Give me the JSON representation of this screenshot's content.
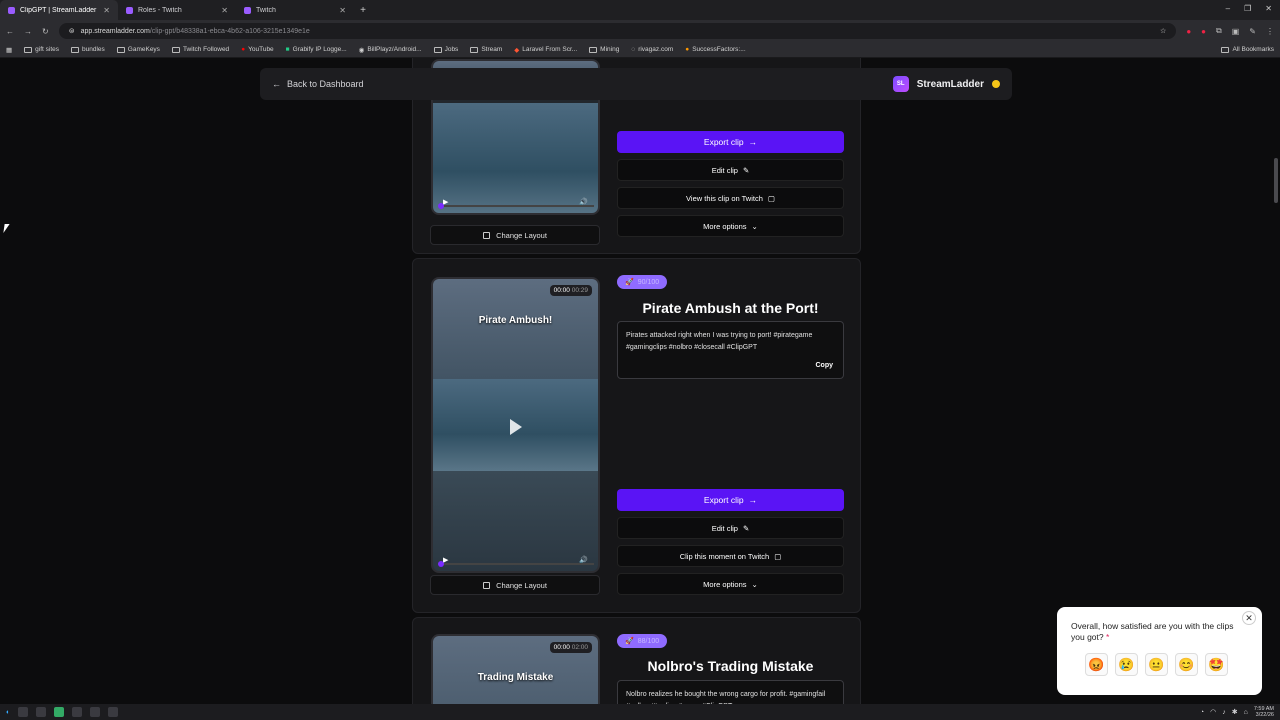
{
  "browser": {
    "tabs": [
      {
        "label": "ClipGPT | StreamLadder",
        "active": true
      },
      {
        "label": "Roles - Twitch",
        "active": false
      },
      {
        "label": "Twitch",
        "active": false
      }
    ],
    "url_host": "app.streamladder.com",
    "url_path": "/clip-gpt/b48338a1-ebca-4b62-a106-3215e1349e1e",
    "bookmarks": [
      "gift sites",
      "bundles",
      "GameKeys",
      "Twitch Followed",
      "YouTube",
      "Grabify IP Logge...",
      "BillPlayz/Android...",
      "Jobs",
      "Stream",
      "Laravel From Scr...",
      "Mining",
      "rivagaz.com",
      "SuccessFactors:..."
    ],
    "all_bookmarks": "All Bookmarks"
  },
  "header": {
    "back_label": "Back to Dashboard",
    "brand_logo": "SL",
    "brand_name": "StreamLadder"
  },
  "clips": [
    {
      "export_label": "Export clip",
      "edit_label": "Edit clip",
      "twitch_label": "View this clip on Twitch",
      "more_label": "More options",
      "layout_label": "Change Layout"
    },
    {
      "score": "90/100",
      "time_current": "00:00",
      "time_total": "00:29",
      "video_title": "Pirate Ambush!",
      "title": "Pirate Ambush at the Port!",
      "description": "Pirates attacked right when I was trying to port! #pirategame #gamingclips #nolbro #closecall #ClipGPT",
      "copy_label": "Copy",
      "export_label": "Export clip",
      "edit_label": "Edit clip",
      "twitch_label": "Clip this moment on Twitch",
      "more_label": "More options",
      "layout_label": "Change Layout"
    },
    {
      "score": "88/100",
      "time_current": "00:00",
      "time_total": "02:00",
      "video_title": "Trading Mistake",
      "title": "Nolbro's Trading Mistake",
      "description": "Nolbro realizes he bought the wrong cargo for profit. #gamingfail #nolbro #trading #game #ClipGPT"
    }
  ],
  "survey": {
    "question": "Overall, how satisfied are you with the clips you got?",
    "required_mark": "*",
    "options": [
      "😡",
      "😢",
      "😐",
      "😊",
      "🤩"
    ]
  },
  "taskbar": {
    "time": "7:59 AM",
    "date": "3/22/26"
  },
  "colors": {
    "accent": "#5a14f5",
    "score_badge": "#8f6bff"
  }
}
